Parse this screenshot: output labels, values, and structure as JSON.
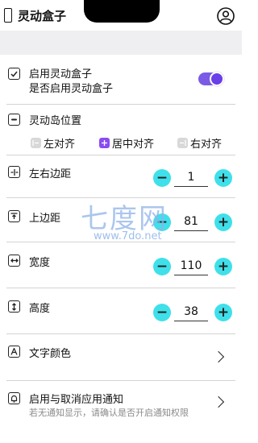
{
  "header": {
    "title": "灵动盒子"
  },
  "enable": {
    "label": "启用灵动盒子",
    "sub": "是否启用灵动盒子",
    "on": true
  },
  "position": {
    "label": "灵动岛位置",
    "options": [
      "左对齐",
      "居中对齐",
      "右对齐"
    ],
    "selected": "居中对齐"
  },
  "margin_lr": {
    "label": "左右边距",
    "value": "1"
  },
  "margin_top": {
    "label": "上边距",
    "value": "81"
  },
  "width": {
    "label": "宽度",
    "value": "110"
  },
  "height": {
    "label": "高度",
    "value": "38"
  },
  "text_color": {
    "label": "文字颜色"
  },
  "notify": {
    "label": "启用与取消应用通知",
    "hint": "若无通知显示，请确认是否开启通知权限"
  },
  "stepper": {
    "minus": "−",
    "plus": "+"
  },
  "watermark": {
    "logo": "七度网",
    "url": "www.7do.net"
  },
  "colors": {
    "accent": "#7b5be6",
    "stepper": "#3fe0ea",
    "band": "#efeff2"
  }
}
